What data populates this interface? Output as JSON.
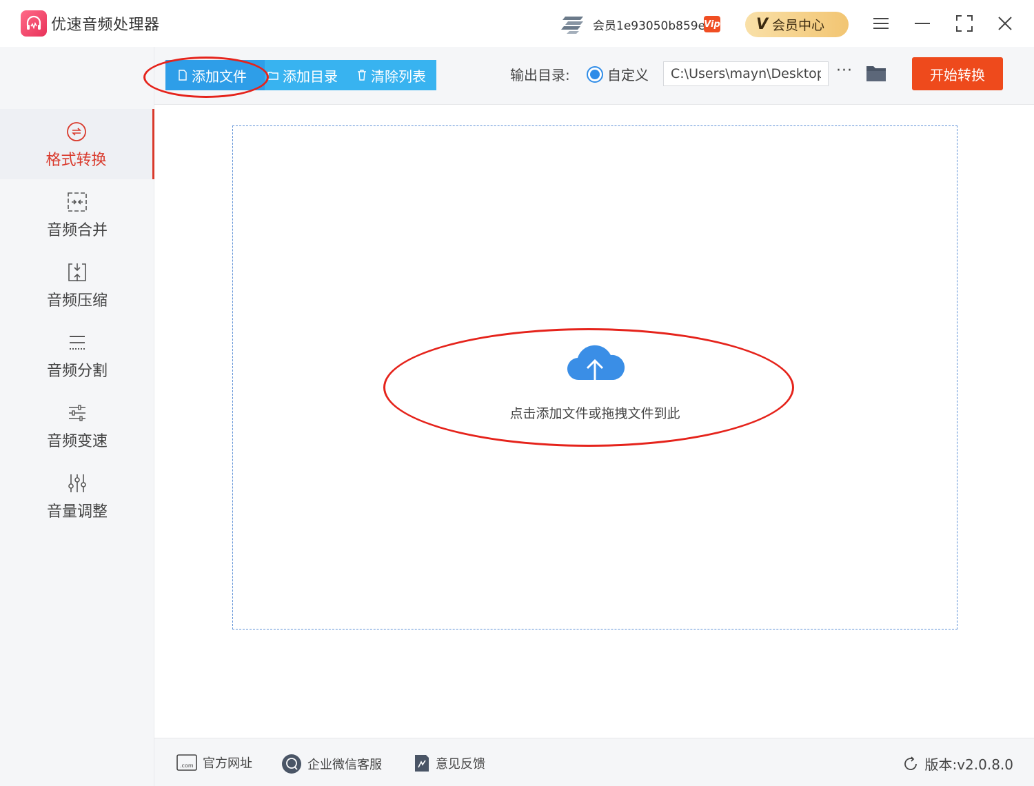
{
  "app": {
    "title": "优速音频处理器"
  },
  "account": {
    "user_name": "会员1e93050b859e",
    "vip_badge": "Vip",
    "vip_center_label": "会员中心",
    "vip_center_mark": "V"
  },
  "sidebar": {
    "items": [
      {
        "label": "格式转换",
        "icon": "convert-icon",
        "active": true
      },
      {
        "label": "音频合并",
        "icon": "merge-icon"
      },
      {
        "label": "音频压缩",
        "icon": "compress-icon"
      },
      {
        "label": "音频分割",
        "icon": "split-icon"
      },
      {
        "label": "音频变速",
        "icon": "speed-icon"
      },
      {
        "label": "音量调整",
        "icon": "volume-icon"
      }
    ]
  },
  "toolbar": {
    "add_file": "添加文件",
    "add_folder": "添加目录",
    "clear_list": "清除列表",
    "output_label": "输出目录:",
    "custom_option": "自定义",
    "output_path": "C:\\Users\\mayn\\Desktop",
    "more": "···",
    "start": "开始转换"
  },
  "dropzone": {
    "hint": "点击添加文件或拖拽文件到此"
  },
  "footer": {
    "website": "官方网址",
    "wechat_service": "企业微信客服",
    "feedback": "意见反馈",
    "version": "版本:v2.0.8.0",
    "com_badge": ".com"
  },
  "colors": {
    "accent_blue": "#38b3f0",
    "active_red": "#d9392b",
    "start_orange": "#ee4a1c",
    "annotation_red": "#e5231b"
  }
}
